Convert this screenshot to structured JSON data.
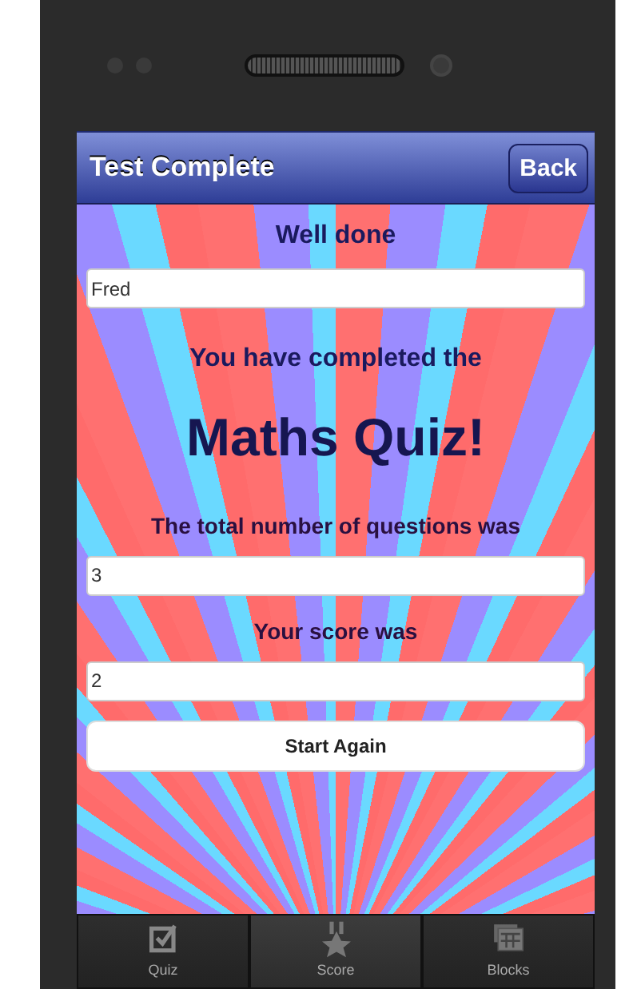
{
  "header": {
    "title": "Test Complete",
    "back_button": "Back"
  },
  "content": {
    "greeting": "Well done",
    "name_field": {
      "value": "Fred"
    },
    "completed_text": "You have completed the",
    "quiz_title": "Maths Quiz!",
    "total_label": "The total number of questions was",
    "total_field": {
      "value": "3"
    },
    "score_label": "Your score was",
    "score_field": {
      "value": "2"
    },
    "button": "Start Again"
  },
  "tabs": [
    {
      "label": "Quiz",
      "kind": "check",
      "selected": false
    },
    {
      "label": "Score",
      "kind": "star",
      "selected": true
    },
    {
      "label": "Blocks",
      "kind": "blocks",
      "selected": false
    }
  ]
}
